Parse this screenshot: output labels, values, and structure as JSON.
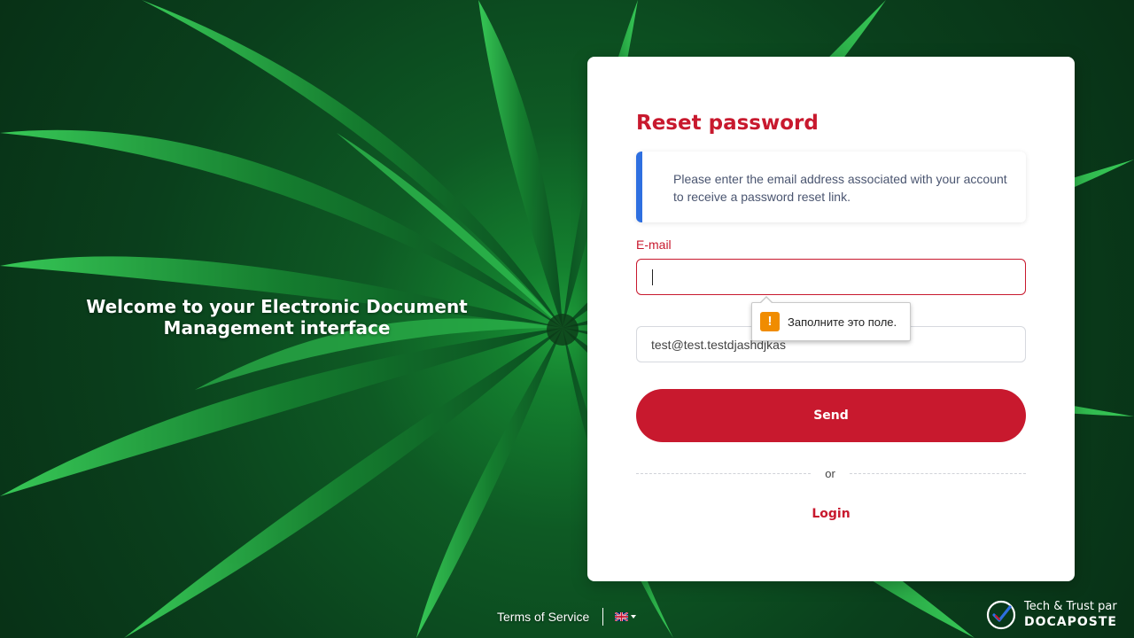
{
  "background": {
    "image": "green-plant-foliage",
    "accent_color": "#1e9c3a"
  },
  "hero": {
    "line1": "Welcome to your Electronic Document",
    "line2": "Management interface"
  },
  "card": {
    "title": "Reset password",
    "info": "Please enter the email address associated with your account to receive a password reset link.",
    "email_label": "E-mail",
    "email_value": "",
    "second_value": "test@test.testdjashdjkas",
    "validation_tooltip": "Заполните это поле.",
    "send_label": "Send",
    "or_label": "or",
    "login_label": "Login"
  },
  "colors": {
    "brand_red": "#c8192e",
    "info_accent": "#2e6fe0",
    "warning": "#f08c00"
  },
  "footer": {
    "terms_label": "Terms of Service",
    "language_flag": "uk-flag-icon",
    "brand_line1": "Tech & Trust par",
    "brand_line2": "DOCAPOSTE"
  }
}
